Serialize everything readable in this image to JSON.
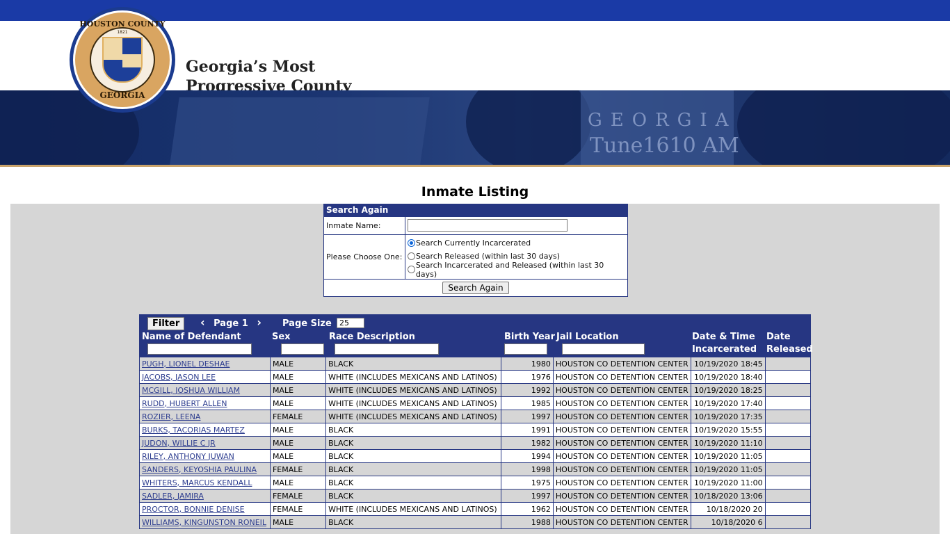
{
  "header": {
    "seal_top": "HOUSTON COUNTY",
    "seal_year": "1821",
    "seal_bottom": "GEORGIA",
    "tagline_line1": "Georgia’s Most",
    "tagline_line2": "Progressive County",
    "banner_text1": "GEORGIA",
    "banner_text2": "Tune1610 AM"
  },
  "page_title": "Inmate Listing",
  "search": {
    "header": "Search Again",
    "name_label": "Inmate Name:",
    "name_value": "",
    "choose_label": "Please Choose One:",
    "options": [
      {
        "label": "Search Currently Incarcerated",
        "selected": true
      },
      {
        "label": "Search Released (within last 30 days)",
        "selected": false
      },
      {
        "label": "Search Incarcerated and Released (within last 30 days)",
        "selected": false
      }
    ],
    "button_label": "Search Again"
  },
  "grid": {
    "filter_label": "Filter",
    "prev_icon": "chevron-left-icon",
    "page_label": "Page 1",
    "next_icon": "chevron-right-icon",
    "page_size_label": "Page Size",
    "page_size_value": "25",
    "columns": [
      "Name of Defendant",
      "Sex",
      "Race Description",
      "Birth Year",
      "Jail Location",
      "Date & Time Incarcerated",
      "Date Released"
    ],
    "col_dt_line1": "Date & Time",
    "col_dt_line2": "Incarcerated",
    "col_dr_line1": "Date",
    "col_dr_line2": "Released",
    "rows": [
      {
        "name": "PUGH, LIONEL DESHAE",
        "sex": "MALE",
        "race": "BLACK",
        "birth": "1980",
        "location": "HOUSTON CO DETENTION CENTER",
        "incarcerated": "10/19/2020 18:45",
        "released": ""
      },
      {
        "name": "JACOBS, JASON LEE",
        "sex": "MALE",
        "race": "WHITE (INCLUDES MEXICANS AND LATINOS)",
        "birth": "1976",
        "location": "HOUSTON CO DETENTION CENTER",
        "incarcerated": "10/19/2020 18:40",
        "released": ""
      },
      {
        "name": "MCGILL, JOSHUA WILLIAM",
        "sex": "MALE",
        "race": "WHITE (INCLUDES MEXICANS AND LATINOS)",
        "birth": "1992",
        "location": "HOUSTON CO DETENTION CENTER",
        "incarcerated": "10/19/2020 18:25",
        "released": ""
      },
      {
        "name": "RUDD, HUBERT ALLEN",
        "sex": "MALE",
        "race": "WHITE (INCLUDES MEXICANS AND LATINOS)",
        "birth": "1985",
        "location": "HOUSTON CO DETENTION CENTER",
        "incarcerated": "10/19/2020 17:40",
        "released": ""
      },
      {
        "name": "ROZIER, LEENA",
        "sex": "FEMALE",
        "race": "WHITE (INCLUDES MEXICANS AND LATINOS)",
        "birth": "1997",
        "location": "HOUSTON CO DETENTION CENTER",
        "incarcerated": "10/19/2020 17:35",
        "released": ""
      },
      {
        "name": "BURKS, TACORIAS MARTEZ",
        "sex": "MALE",
        "race": "BLACK",
        "birth": "1991",
        "location": "HOUSTON CO DETENTION CENTER",
        "incarcerated": "10/19/2020 15:55",
        "released": ""
      },
      {
        "name": "JUDON, WILLIE C JR",
        "sex": "MALE",
        "race": "BLACK",
        "birth": "1982",
        "location": "HOUSTON CO DETENTION CENTER",
        "incarcerated": "10/19/2020 11:10",
        "released": ""
      },
      {
        "name": "RILEY, ANTHONY JUWAN",
        "sex": "MALE",
        "race": "BLACK",
        "birth": "1994",
        "location": "HOUSTON CO DETENTION CENTER",
        "incarcerated": "10/19/2020 11:05",
        "released": ""
      },
      {
        "name": "SANDERS, KEYOSHIA PAULINA",
        "sex": "FEMALE",
        "race": "BLACK",
        "birth": "1998",
        "location": "HOUSTON CO DETENTION CENTER",
        "incarcerated": "10/19/2020 11:05",
        "released": ""
      },
      {
        "name": "WHITERS, MARCUS KENDALL",
        "sex": "MALE",
        "race": "BLACK",
        "birth": "1975",
        "location": "HOUSTON CO DETENTION CENTER",
        "incarcerated": "10/19/2020 11:00",
        "released": ""
      },
      {
        "name": "SADLER, JAMIRA",
        "sex": "FEMALE",
        "race": "BLACK",
        "birth": "1997",
        "location": "HOUSTON CO DETENTION CENTER",
        "incarcerated": "10/18/2020 13:06",
        "released": ""
      },
      {
        "name": "PROCTOR, BONNIE DENISE",
        "sex": "FEMALE",
        "race": "WHITE (INCLUDES MEXICANS AND LATINOS)",
        "birth": "1962",
        "location": "HOUSTON CO DETENTION CENTER",
        "incarcerated": "10/18/2020 20",
        "released": ""
      },
      {
        "name": "WILLIAMS, KINGUNSTON RONEIL",
        "sex": "MALE",
        "race": "BLACK",
        "birth": "1988",
        "location": "HOUSTON CO DETENTION CENTER",
        "incarcerated": "10/18/2020 6",
        "released": ""
      }
    ]
  },
  "colors": {
    "accent": "#263682",
    "top_bar": "#1a3aa6",
    "tan": "#c9a36b"
  }
}
